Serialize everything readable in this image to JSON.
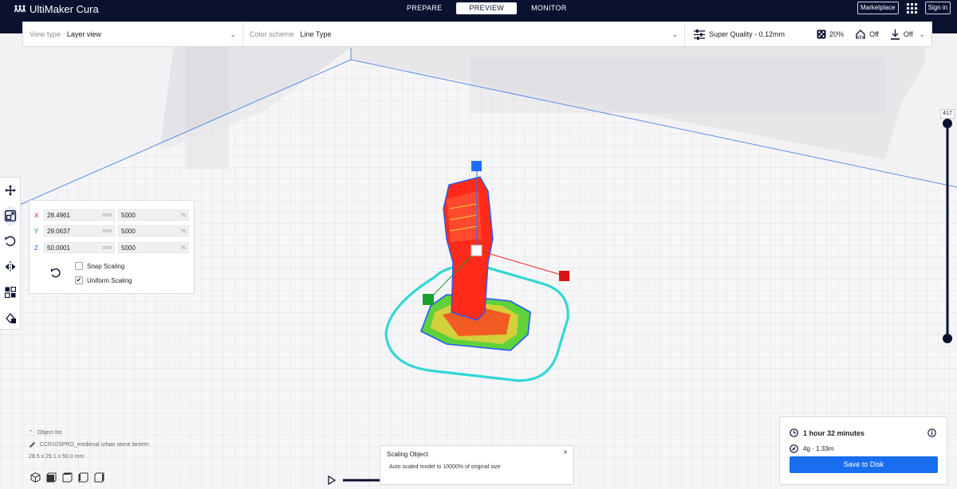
{
  "app": {
    "title": "UltiMaker Cura"
  },
  "stages": [
    {
      "label": "PREPARE",
      "active": false
    },
    {
      "label": "PREVIEW",
      "active": true
    },
    {
      "label": "MONITOR",
      "active": false
    }
  ],
  "topbar": {
    "marketplace": "Marketplace",
    "sign_in": "Sign in"
  },
  "toolbar": {
    "view_type_label": "View type",
    "view_type_value": "Layer view",
    "color_scheme_label": "Color scheme",
    "color_scheme_value": "Line Type",
    "profile": "Super Quality - 0.12mm",
    "infill": "20%",
    "support": "Off",
    "adhesion": "Off"
  },
  "tools": [
    {
      "name": "move-tool",
      "icon": "move-icon"
    },
    {
      "name": "scale-tool",
      "icon": "scale-icon"
    },
    {
      "name": "rotate-tool",
      "icon": "rotate-icon"
    },
    {
      "name": "mirror-tool",
      "icon": "mirror-icon"
    },
    {
      "name": "per-model-settings-tool",
      "icon": "per-model-settings-icon"
    },
    {
      "name": "support-blocker-tool",
      "icon": "support-blocker-icon"
    }
  ],
  "scale": {
    "x": {
      "axis": "X",
      "mm": "28.4961",
      "pct": "5000"
    },
    "y": {
      "axis": "Y",
      "mm": "29.0637",
      "pct": "5000"
    },
    "z": {
      "axis": "Z",
      "mm": "50.0001",
      "pct": "5000"
    },
    "unit_mm": "mm",
    "unit_pct": "%",
    "snap_scaling": "Snap Scaling",
    "snap_checked": false,
    "uniform_scaling": "Uniform Scaling",
    "uniform_checked": true,
    "check_mark": "✔"
  },
  "layer_slider": {
    "top_value": "417"
  },
  "object_list": {
    "title": "Object list",
    "object_name": "CCR10SPRO_medieval urban stone lantern",
    "dimensions": "28.5 x 29.1 x 50.0 mm"
  },
  "notification": {
    "title": "Scaling Object",
    "message": "Auto scaled model to 10000% of original size",
    "close": "×"
  },
  "print_info": {
    "time": "1 hour 32 minutes",
    "material": "4g · 1.33m",
    "save_button": "Save to Disk"
  },
  "colors": {
    "topbar": "#0b1230",
    "accent": "#196ef0",
    "model": "#ff2a1a",
    "skirt": "#33d6d6",
    "infill": "#e8d03c",
    "support": "#5fd23a"
  }
}
